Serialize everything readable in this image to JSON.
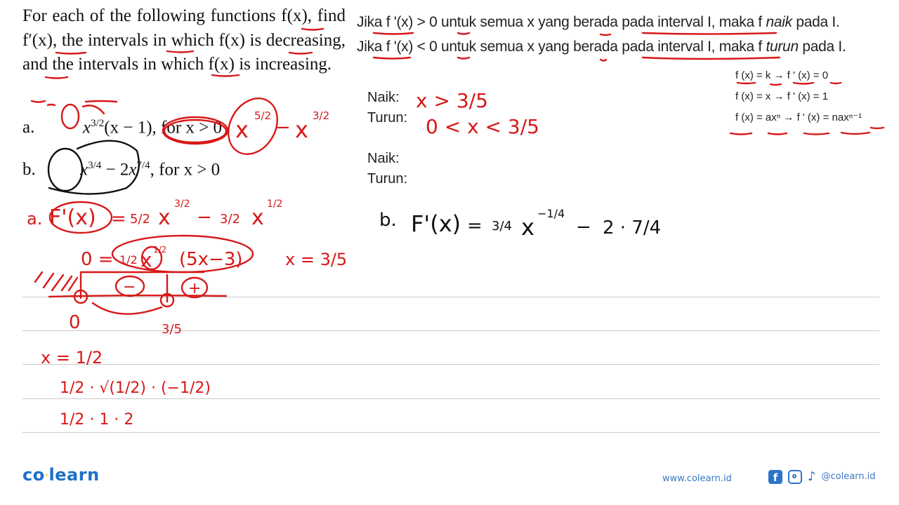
{
  "problem": {
    "intro": "For each of the following functions f(x), find f′(x), the intervals in which f(x) is decreasing, and the intervals in which f(x) is increasing.",
    "items": [
      {
        "label": "a.",
        "base": "x",
        "exp": "3/2",
        "rest": "(x − 1), for x > 0"
      },
      {
        "label": "b.",
        "term1_base": "x",
        "term1_exp": "3/4",
        "minus": " − 2",
        "term2_base": "x",
        "term2_exp": "7/4",
        "rest": ", for x > 0"
      }
    ]
  },
  "rules": {
    "line1": {
      "pre": "Jika ",
      "cond": "f '(x) > 0",
      "mid": " untuk semua x yang berada pada interval I, maka f ",
      "word": "naik",
      "post": " pada I."
    },
    "line2": {
      "pre": "Jika ",
      "cond": "f '(x) < 0",
      "mid": " untuk semua x yang berada pada interval I, maka f ",
      "word": "turun",
      "post": " pada I."
    },
    "formulas": [
      "f (x) = k → f ' (x) = 0",
      "f (x) = x → f ' (x) = 1",
      "f (x) = axⁿ → f ' (x) = naxⁿ⁻¹"
    ]
  },
  "answers": {
    "a": {
      "naik_label": "Naik:",
      "turun_label": "Turun:",
      "naik_value": "x > 3/5",
      "turun_value": "0 < x < 3/5"
    },
    "b": {
      "naik_label": "Naik:",
      "turun_label": "Turun:"
    }
  },
  "handwriting": {
    "a_rewrite": {
      "term1": "x",
      "exp1": "5/2",
      "minus": "−",
      "term2": "x",
      "exp2": "3/2"
    },
    "a_derivative": {
      "label": "a.",
      "lhs": "F'(x)",
      "eq": "=",
      "c1": "5/2",
      "e1": "3/2",
      "minus": "−",
      "c2": "3/2",
      "e2": "1/2"
    },
    "a_factor": {
      "lhs": "0 =",
      "c": "1/2",
      "e": "1/2",
      "factor": "(5x−3)",
      "root": "x = 3/5"
    },
    "sign_chart": {
      "signs": [
        "−",
        "+"
      ],
      "points": [
        "0",
        "3/5"
      ]
    },
    "test": {
      "x": "x = 1/2",
      "step1": "1/2 · √(1/2) · (−1/2)",
      "step2": "1/2 · 1 · 2"
    },
    "b_derivative": {
      "label": "b.",
      "lhs": "F'(x)",
      "eq": "=",
      "c1": "3/4",
      "e1": "−1/4",
      "minus": "−",
      "c2": "2 · 7/4"
    }
  },
  "footer": {
    "logo_left": "co",
    "logo_right": "learn",
    "website": "www.colearn.id",
    "handle": "@colearn.id",
    "icons": [
      "facebook-icon",
      "instagram-icon",
      "tiktok-icon"
    ]
  },
  "colors": {
    "ink": "#d71818",
    "brand": "#1f6fc5",
    "logo_dot": "#f4c430"
  }
}
